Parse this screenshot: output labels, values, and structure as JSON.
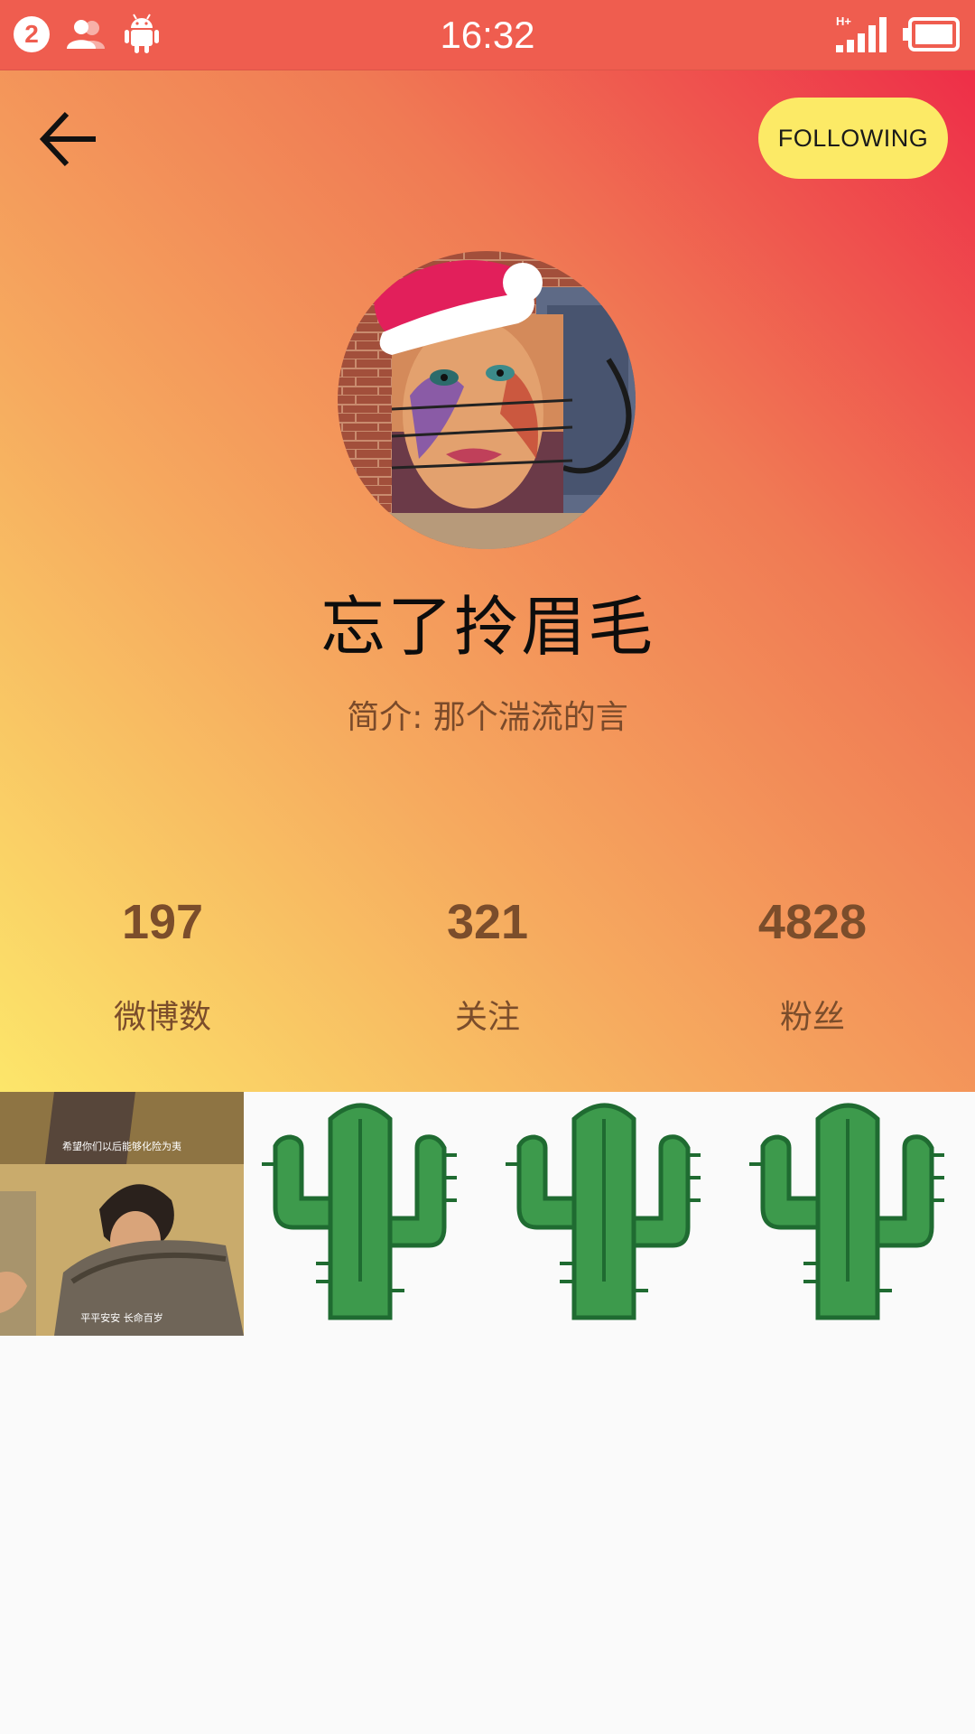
{
  "status_bar": {
    "notification_count": "2",
    "time": "16:32",
    "network_label": "H+",
    "icons": [
      "notification-badge-icon",
      "contacts-icon",
      "android-icon",
      "signal-icon",
      "battery-icon"
    ]
  },
  "header": {
    "back_icon": "arrow-left-icon",
    "follow_button_label": "FOLLOWING",
    "follow_button_color": "#fcea66"
  },
  "profile": {
    "username": "忘了拎眉毛",
    "intro": "简介:  那个湍流的言"
  },
  "stats": [
    {
      "value": "197",
      "label": "微博数"
    },
    {
      "value": "321",
      "label": "关注"
    },
    {
      "value": "4828",
      "label": "粉丝"
    }
  ],
  "grid": {
    "photo_caption_top": "希望你们以后能够化险为夷",
    "photo_caption_bottom": "平平安安 长命百岁",
    "placeholder_icon": "cactus-icon",
    "placeholder_color": "#3d9a4c"
  },
  "colors": {
    "status_bar": "#ef5d4f",
    "gradient_start": "#fce66a",
    "gradient_end": "#ee2e48",
    "stat_text": "#7b4d2b"
  }
}
